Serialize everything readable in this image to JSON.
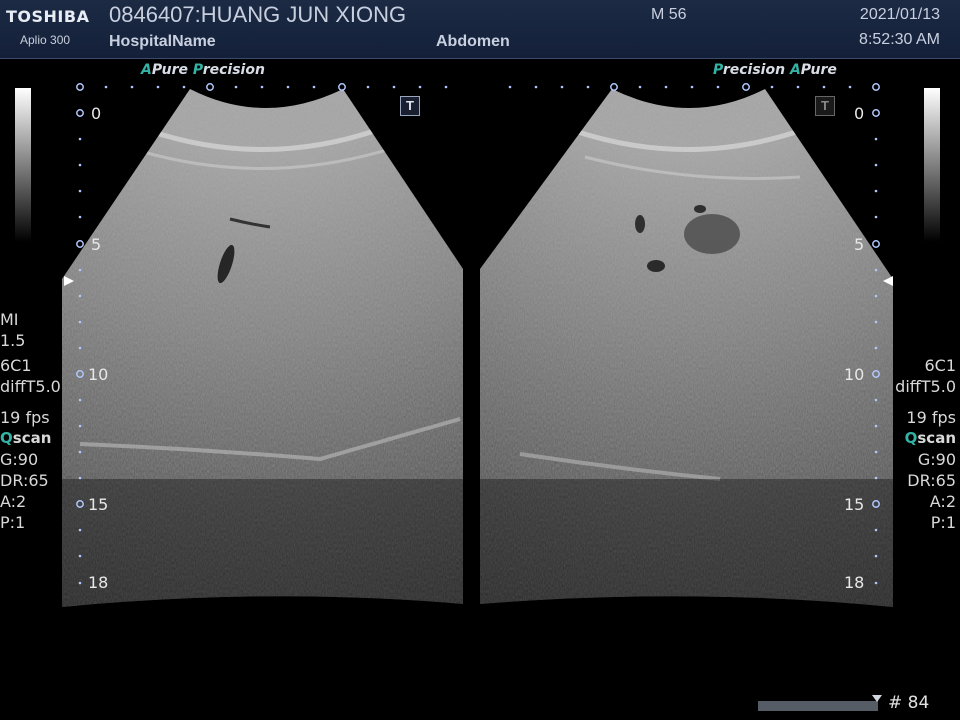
{
  "header": {
    "brand": "TOSHIBA",
    "model": "Aplio 300",
    "patient": "0846407:HUANG JUN XIONG",
    "hospital": "HospitalName",
    "age_sex": "M 56",
    "exam": "Abdomen",
    "date": "2021/01/13",
    "time": "8:52:30 AM"
  },
  "left_view": {
    "logo_a": "A",
    "logo_pure": "Pure",
    "logo_p": "P",
    "logo_recision": "recision",
    "depth_labels": [
      "0",
      "5",
      "10",
      "15",
      "18"
    ],
    "t_marker": "T"
  },
  "right_view": {
    "logo_p": "P",
    "logo_recision": "recision",
    "logo_a": "A",
    "logo_pure": "Pure",
    "depth_labels": [
      "0",
      "5",
      "10",
      "15",
      "18"
    ],
    "t_marker": "T"
  },
  "left_params": {
    "mi_label": "MI",
    "mi_value": "1.5",
    "probe": "6C1",
    "mode": "diffT5.0",
    "fps": "19 fps",
    "qscan_q": "Q",
    "qscan_rest": "scan",
    "gain": "G:90",
    "dr": "DR:65",
    "a": "A:2",
    "p": "P:1"
  },
  "right_params": {
    "probe": "6C1",
    "mode": "diffT5.0",
    "fps": "19 fps",
    "qscan_q": "Q",
    "qscan_rest": "scan",
    "gain": "G:90",
    "dr": "DR:65",
    "a": "A:2",
    "p": "P:1"
  },
  "cine": {
    "frame": "# 84",
    "position": 1.0
  },
  "colors": {
    "header_bg": "#14203a",
    "accent_teal": "#33b3a6",
    "scale_dot": "#b0c8ff"
  }
}
